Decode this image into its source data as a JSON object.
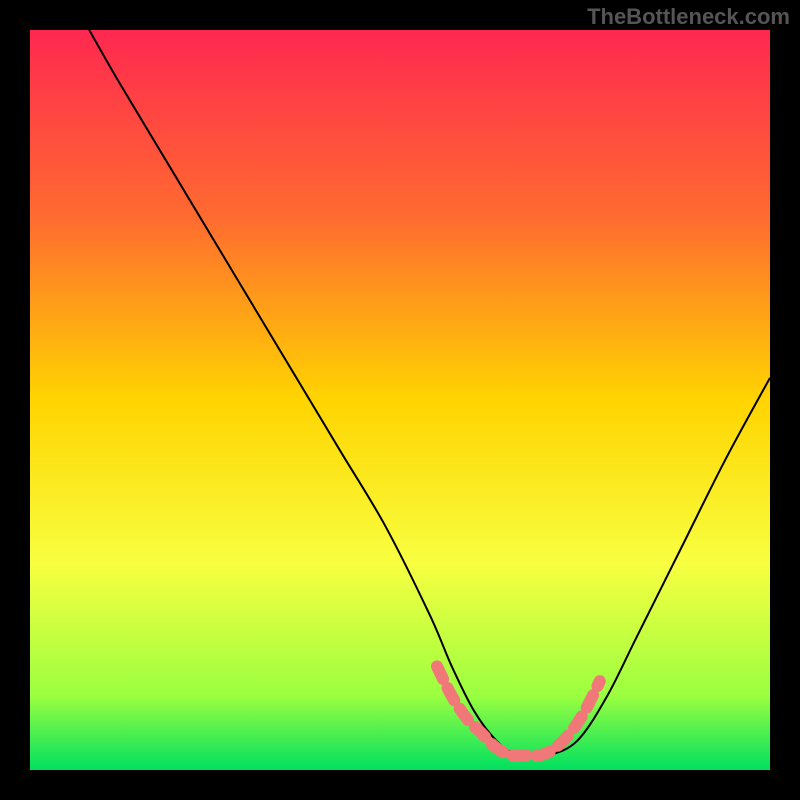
{
  "watermark": "TheBottleneck.com",
  "chart_data": {
    "type": "line",
    "title": "",
    "xlabel": "",
    "ylabel": "",
    "xlim": [
      0,
      100
    ],
    "ylim": [
      0,
      100
    ],
    "background_gradient_colors": {
      "top": "#ff2850",
      "upper_mid": "#ff6a30",
      "mid": "#ffd400",
      "lower": "#f8ff40",
      "near_bottom": "#9aff40",
      "bottom": "#00e060"
    },
    "curve": {
      "name": "bottleneck-curve",
      "stroke": "#000000",
      "x": [
        8,
        12,
        18,
        24,
        30,
        36,
        42,
        48,
        54,
        57,
        60,
        63,
        66,
        70,
        74,
        78,
        82,
        88,
        94,
        100
      ],
      "y": [
        100,
        93,
        83,
        73,
        63,
        53,
        43,
        33,
        21,
        14,
        8,
        4,
        2,
        2,
        4,
        10,
        18,
        30,
        42,
        53
      ]
    },
    "optimal_band": {
      "name": "optimal-zone-marker",
      "stroke": "#f07878",
      "x": [
        55,
        57,
        59,
        61,
        63,
        65,
        67,
        69,
        71,
        73,
        75,
        77
      ],
      "y": [
        14,
        10,
        7,
        5,
        3,
        2,
        2,
        2,
        3,
        5,
        8,
        12
      ]
    }
  }
}
